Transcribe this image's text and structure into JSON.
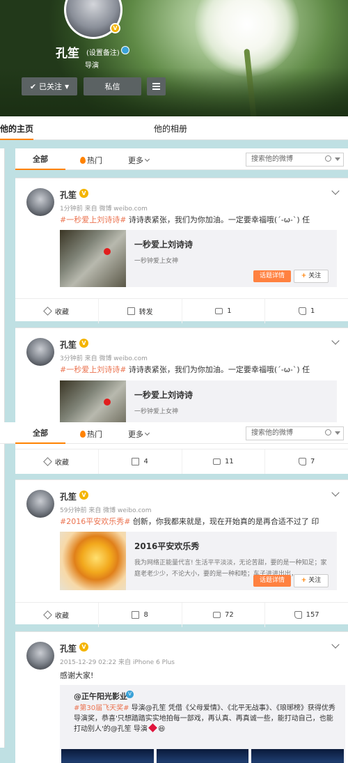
{
  "profile": {
    "name": "孔笙",
    "remark": "(设置备注)",
    "title": "导演",
    "follow_label": "已关注",
    "message_label": "私信",
    "v_mark": "V"
  },
  "tabs": {
    "home": "他的主页",
    "album": "他的相册"
  },
  "filter": {
    "all": "全部",
    "hot": "热门",
    "more": "更多",
    "search_placeholder": "搜索他的微博"
  },
  "posts": [
    {
      "author": "孔笙",
      "meta": "1分钟前 来自 微博 weibo.com",
      "tag": "#一秒爱上刘诗诗#",
      "text": " 诗诗表紧张，我们为你加油。一定要幸福哦(´-ω-`) 任",
      "topic_title": "一秒爱上刘诗诗",
      "topic_sub": "一秒钟爱上女神",
      "topic_btn": "话题详情",
      "topic_follow": "关注",
      "actions": {
        "fav": "收藏",
        "share": "转发",
        "comment": "1",
        "like": "1"
      }
    },
    {
      "author": "孔笙",
      "meta": "3分钟前 来自 微博 weibo.com",
      "tag": "#一秒爱上刘诗诗#",
      "text": " 诗诗表紧张，我们为你加油。一定要幸福哦(´-ω-`) 任",
      "topic_title": "一秒爱上刘诗诗",
      "topic_sub": "一秒钟爱上女神",
      "actions": {
        "fav": "收藏",
        "share": "4",
        "comment": "11",
        "like": "7"
      }
    },
    {
      "author": "孔笙",
      "meta": "59分钟前 来自 微博 weibo.com",
      "tag": "#2016平安欢乐秀#",
      "text": " 创新，你我都来就是，现在开始真的是再合适不过了 印",
      "topic_title": "2016平安欢乐秀",
      "topic_sub": "我为网络正能量代言! 生活平平淡淡，无论苦甜，要的是一种知足；家庭老老少少，不论大小，要的是一种和睦；车子进进出出，",
      "topic_btn": "话题详情",
      "topic_follow": "关注",
      "actions": {
        "fav": "收藏",
        "share": "8",
        "comment": "72",
        "like": "157"
      }
    },
    {
      "author": "孔笙",
      "meta": "2015-12-29 02:22 来自 iPhone 6 Plus",
      "text": "感谢大家!",
      "repost_author": "@正午阳光影业",
      "repost_v": "V",
      "repost_tag": "#第30届飞天奖#",
      "repost_text": " 导演@孔笙 凭借《父母爱情》、《北平无战事》、《琅琊榜》获得优秀导演奖，恭喜'只想踏踏实实地拍每一部戏，再认真、再真诚一些，能打动自己，也能打动别人'的@孔笙 导演"
    }
  ]
}
